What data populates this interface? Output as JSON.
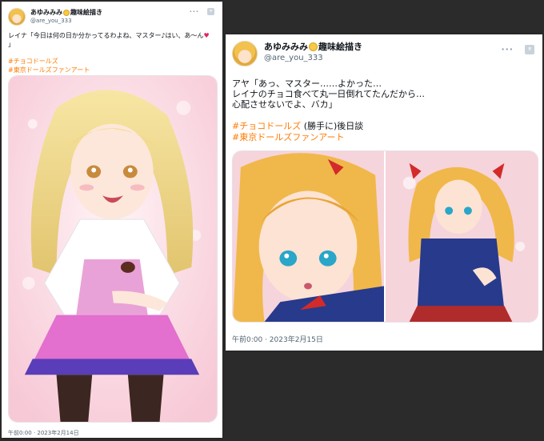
{
  "tweet1": {
    "display_name": "あゆみみみ",
    "display_name_suffix": "趣味絵描き",
    "handle": "@are_you_333",
    "more_glyph": "···",
    "x_glyph": "ᵍ",
    "text": "レイナ「今日は何の日か分かってるわよね、マスター♪はい、あ～ん",
    "text_end": "」",
    "hashtags": [
      "#チョコドールズ",
      "#東京ドールズファンアート"
    ],
    "timestamp": "午前0:00 · 2023年2月14日"
  },
  "tweet2": {
    "display_name": "あゆみみみ",
    "display_name_suffix": "趣味絵描き",
    "handle": "@are_you_333",
    "more_glyph": "···",
    "x_glyph": "ᵍ",
    "line1": "アヤ「あっ、マスター……よかった…",
    "line2": "レイナのチョコ食べて丸一日倒れてたんだから…",
    "line3": "心配させないでよ、バカ」",
    "hashtag1": "#チョコドールズ",
    "hashtag1_suffix": " (勝手に)後日談",
    "hashtag2": "#東京ドールズファンアート",
    "timestamp": "午前0:00 · 2023年2月15日"
  },
  "colors": {
    "hashtag": "#ff7a00",
    "heart": "#e0245e",
    "background": "#2b2b2b"
  }
}
